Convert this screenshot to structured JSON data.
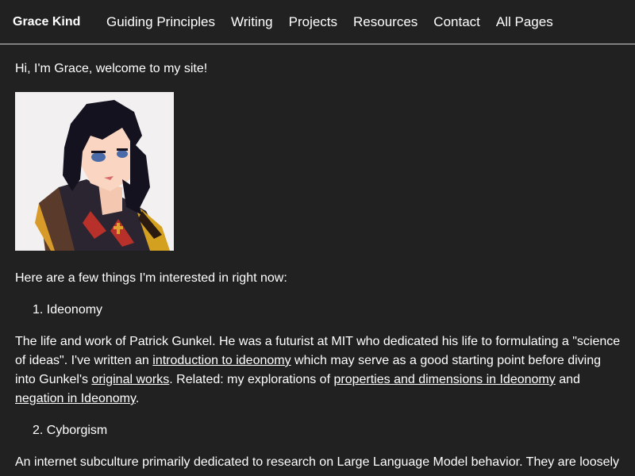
{
  "header": {
    "brand": "Grace Kind",
    "nav": [
      {
        "label": "Guiding Principles"
      },
      {
        "label": "Writing"
      },
      {
        "label": "Projects"
      },
      {
        "label": "Resources"
      },
      {
        "label": "Contact"
      },
      {
        "label": "All Pages"
      }
    ]
  },
  "main": {
    "greeting": "Hi, I'm Grace, welcome to my site!",
    "intro": "Here are a few things I'm interested in right now:",
    "interests": [
      {
        "title": "1. Ideonomy",
        "text_1": "The life and work of Patrick Gunkel. He was a futurist at MIT who dedicated his life to formulating a \"science of ideas\". I've written an ",
        "link_1": "introduction to ideonomy",
        "text_2": " which may serve as a good starting point before diving into Gunkel's ",
        "link_2": "original works",
        "text_3": ". Related: my explorations of ",
        "link_3": "properties and dimensions in Ideonomy",
        "text_4": " and ",
        "link_4": "negation in Ideonomy",
        "text_5": "."
      },
      {
        "title": "2. Cyborgism",
        "text_1": "An internet subculture primarily dedicated to research on Large Language Model behavior. They are loosely"
      }
    ]
  },
  "colors": {
    "background": "#212121",
    "text": "#ffffff",
    "divider": "#d0d0d0"
  }
}
